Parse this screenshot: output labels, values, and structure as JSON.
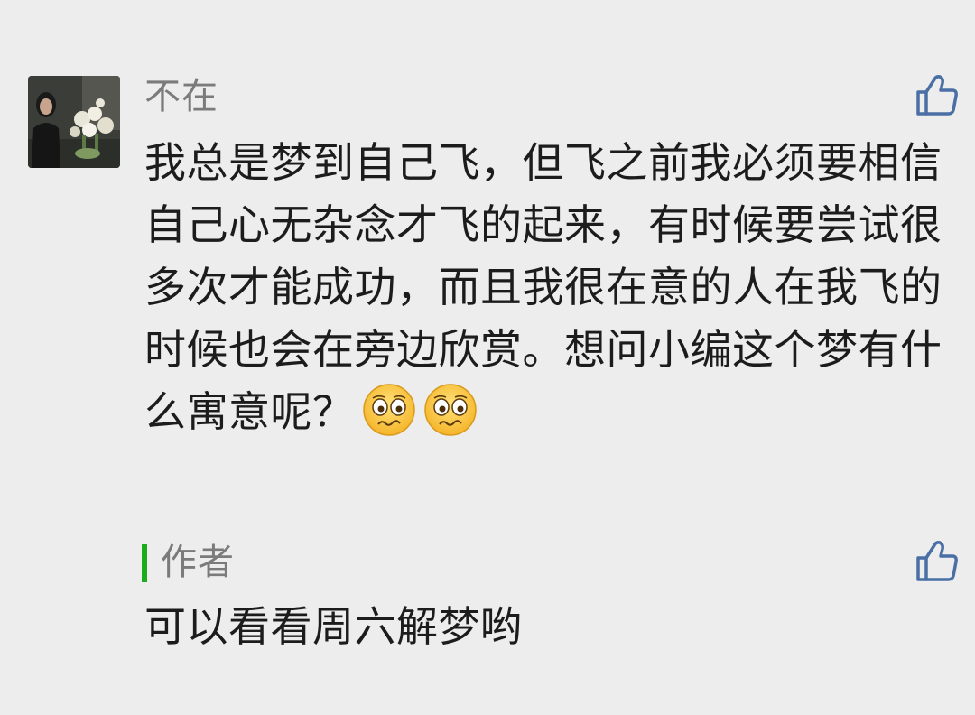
{
  "comment": {
    "nickname": "不在",
    "text": "我总是梦到自己飞，但飞之前我必须要相信自己心无杂念才飞的起来，有时候要尝试很多次才能成功，而且我很在意的人在我飞的时候也会在旁边欣赏。想问小编这个梦有什么寓意呢？",
    "emojis": [
      "pleading-face-icon",
      "pleading-face-icon"
    ]
  },
  "reply": {
    "author_label": "作者",
    "text": "可以看看周六解梦哟"
  },
  "colors": {
    "background": "#ededed",
    "author_accent": "#1aad19",
    "secondary_text": "#7b7b7b",
    "primary_text": "#1c1c1c",
    "like_icon": "#4a6fa5"
  }
}
